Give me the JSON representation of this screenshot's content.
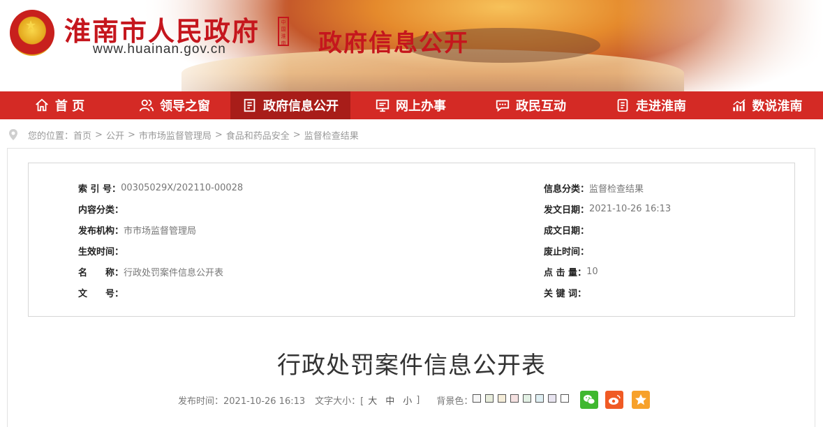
{
  "header": {
    "site_title": "淮南市人民政府",
    "site_url": "www.huainan.gov.cn",
    "seal_text": "中国淮南",
    "section_title": "政府信息公开"
  },
  "nav": [
    {
      "label": "首 页",
      "icon": "home-icon"
    },
    {
      "label": "领导之窗",
      "icon": "people-icon"
    },
    {
      "label": "政府信息公开",
      "icon": "document-icon",
      "active": true
    },
    {
      "label": "网上办事",
      "icon": "monitor-icon"
    },
    {
      "label": "政民互动",
      "icon": "chat-icon"
    },
    {
      "label": "走进淮南",
      "icon": "book-icon"
    },
    {
      "label": "数说淮南",
      "icon": "bar-chart-icon"
    }
  ],
  "breadcrumb": {
    "prefix": "您的位置：",
    "items": [
      "首页",
      "公开",
      "市市场监督管理局",
      "食品和药品安全",
      "监督检查结果"
    ]
  },
  "meta": {
    "left": [
      {
        "label": "索 引 号：",
        "value": "00305029X/202110-00028"
      },
      {
        "label": "内容分类：",
        "value": ""
      },
      {
        "label": "发布机构：",
        "value": "市市场监督管理局"
      },
      {
        "label": "生效时间：",
        "value": ""
      },
      {
        "label": "名　　称：",
        "value": "行政处罚案件信息公开表"
      },
      {
        "label": "文　　号：",
        "value": ""
      }
    ],
    "right": [
      {
        "label": "信息分类：",
        "value": "监督检查结果"
      },
      {
        "label": "发文日期：",
        "value": "2021-10-26 16:13"
      },
      {
        "label": "成文日期：",
        "value": ""
      },
      {
        "label": "废止时间：",
        "value": ""
      },
      {
        "label": "点 击 量：",
        "value": "10"
      },
      {
        "label": "关 键 词：",
        "value": ""
      }
    ]
  },
  "document": {
    "title": "行政处罚案件信息公开表",
    "publish_label": "发布时间：2021-10-26 16:13",
    "font_size_label": "文字大小：[",
    "size_large": "大",
    "size_medium": "中",
    "size_small": "小",
    "font_size_end": "]",
    "bg_label": "背景色：",
    "bg_colors": [
      "#f6f6f6",
      "#e8eddc",
      "#f4ecd8",
      "#f5e1e1",
      "#e2f0e4",
      "#dfeff3",
      "#e8e4f0",
      "#ffffff"
    ]
  },
  "share": [
    {
      "icon": "wechat-icon",
      "color": "#3fb82f"
    },
    {
      "icon": "weibo-icon",
      "color": "#f05a24"
    },
    {
      "icon": "favorite-icon",
      "color": "#f7a12a"
    }
  ]
}
